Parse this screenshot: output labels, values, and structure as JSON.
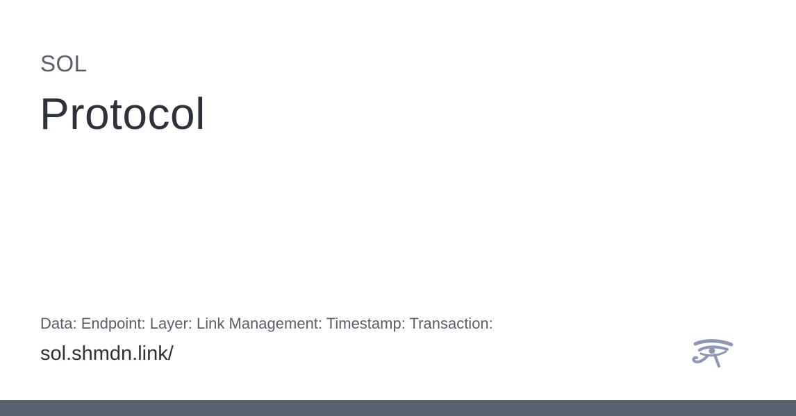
{
  "card": {
    "kicker": "SOL",
    "title": "Protocol",
    "meta": "Data: Endpoint: Layer: Link Management: Timestamp: Transaction:",
    "url": "sol.shmdn.link/"
  },
  "logo": {
    "icon": "eye-of-horus-icon",
    "color": "#8d96b4"
  },
  "footer": {
    "color": "#5b616e"
  }
}
